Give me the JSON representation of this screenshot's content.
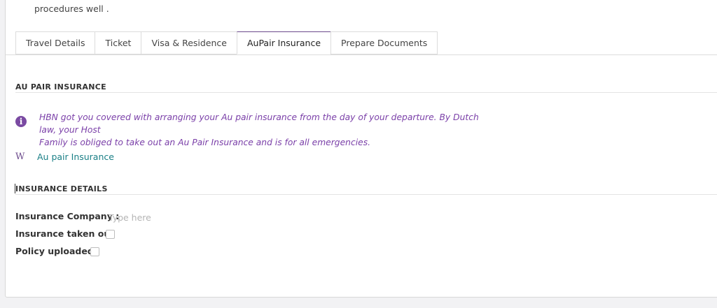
{
  "intro_text": "procedures well .",
  "tabs": [
    {
      "label": "Travel Details"
    },
    {
      "label": "Ticket"
    },
    {
      "label": "Visa & Residence"
    },
    {
      "label": "AuPair Insurance",
      "active": true
    },
    {
      "label": "Prepare Documents"
    }
  ],
  "insurance_section": {
    "title": "AU PAIR INSURANCE",
    "info_line1": "HBN got you covered with arranging your Au pair insurance from the day of your departure. By Dutch law, your Host",
    "info_line2": "Family is obliged to take out an Au Pair Insurance and is for all emergencies.",
    "link_label": "Au pair Insurance",
    "info_icon": "info-icon",
    "link_icon": "wikipedia-icon"
  },
  "details_section": {
    "title": "INSURANCE DETAILS",
    "company_label": "Insurance Company :",
    "company_placeholder": "Type here",
    "company_value": "",
    "taken_out_label": "Insurance taken out",
    "taken_out_checked": false,
    "policy_label": "Policy uploaded",
    "policy_checked": false
  },
  "colors": {
    "accent": "#6c4a8c",
    "info_text": "#7a3fa8",
    "link": "#1a7f86"
  }
}
